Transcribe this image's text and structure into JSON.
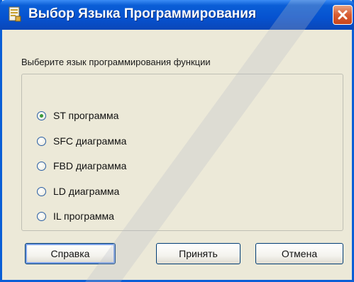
{
  "window": {
    "title": "Выбор Языка Программирования"
  },
  "prompt": "Выберите язык программирования функции",
  "options": [
    {
      "label": "ST программа",
      "checked": true
    },
    {
      "label": "SFC диаграмма",
      "checked": false
    },
    {
      "label": "FBD диаграмма",
      "checked": false
    },
    {
      "label": "LD диаграмма",
      "checked": false
    },
    {
      "label": "IL программа",
      "checked": false
    }
  ],
  "buttons": {
    "help": "Справка",
    "accept": "Принять",
    "cancel": "Отмена"
  },
  "colors": {
    "titlebar": "#0a5ed6",
    "dialog_bg": "#ece9d8",
    "close_button": "#d85c32",
    "radio_selected": "#3a9a3a"
  },
  "icons": {
    "app": "app-icon",
    "close": "close-icon"
  }
}
